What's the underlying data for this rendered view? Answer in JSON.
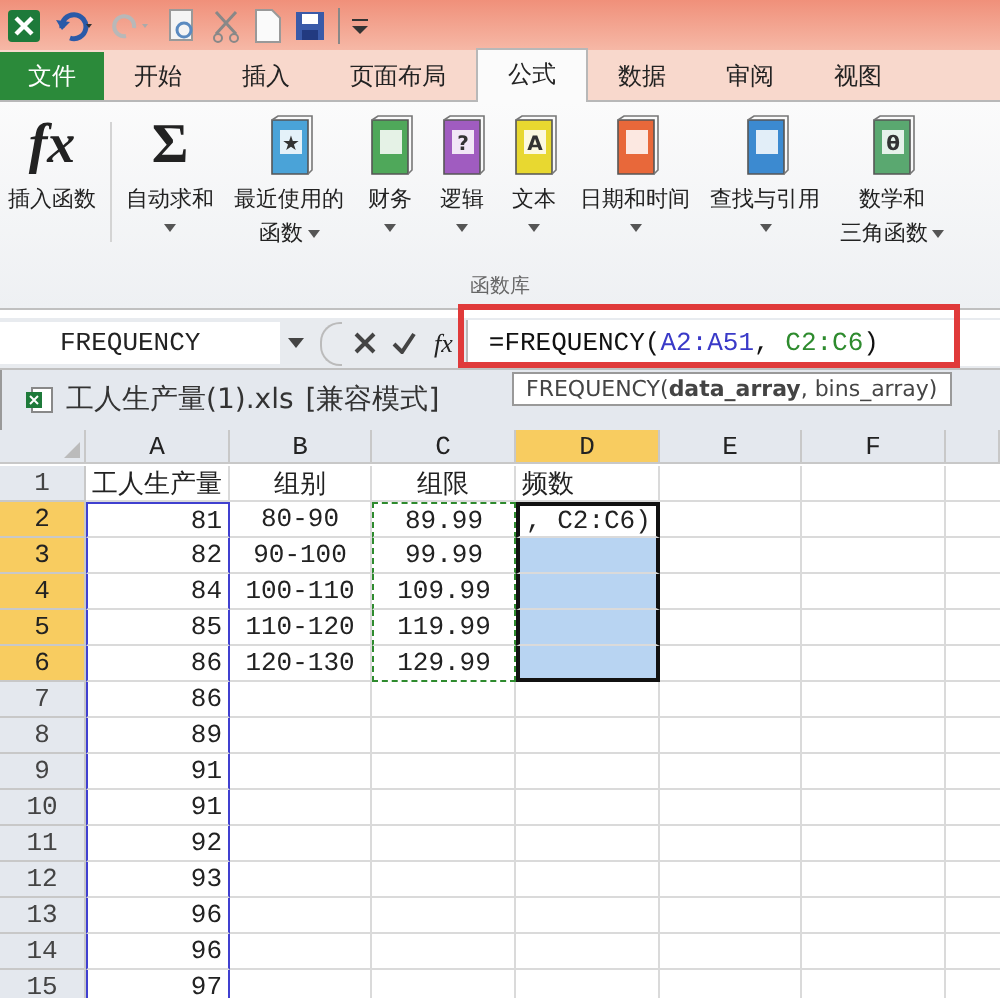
{
  "tabs": [
    {
      "label": "文件",
      "kind": "file",
      "selected": false
    },
    {
      "label": "开始",
      "kind": "normal",
      "selected": false
    },
    {
      "label": "插入",
      "kind": "normal",
      "selected": false
    },
    {
      "label": "页面布局",
      "kind": "normal",
      "selected": false
    },
    {
      "label": "公式",
      "kind": "normal",
      "selected": true
    },
    {
      "label": "数据",
      "kind": "normal",
      "selected": false
    },
    {
      "label": "审阅",
      "kind": "normal",
      "selected": false
    },
    {
      "label": "视图",
      "kind": "normal",
      "selected": false
    }
  ],
  "ribbon": {
    "buttons": [
      {
        "kind": "glyph",
        "glyph": "fx",
        "lines": [
          "插入函数"
        ],
        "dropdown": false
      },
      {
        "kind": "glyph",
        "glyph": "Σ",
        "lines": [
          "自动求和"
        ],
        "dropdown": true
      },
      {
        "kind": "book",
        "color": "#4aa3d8",
        "glyph": "★",
        "lines": [
          "最近使用的",
          "函数"
        ],
        "dropdown": true
      },
      {
        "kind": "book",
        "color": "#4fa85a",
        "lines": [
          "财务"
        ],
        "dropdown": true
      },
      {
        "kind": "book",
        "color": "#a05cc0",
        "glyph": "?",
        "lines": [
          "逻辑"
        ],
        "dropdown": true
      },
      {
        "kind": "book",
        "color": "#e8d830",
        "glyph": "A",
        "lines": [
          "文本"
        ],
        "dropdown": true
      },
      {
        "kind": "book",
        "color": "#e8683a",
        "lines": [
          "日期和时间"
        ],
        "dropdown": true
      },
      {
        "kind": "book",
        "color": "#3c8ad0",
        "lines": [
          "查找与引用"
        ],
        "dropdown": true
      },
      {
        "kind": "book",
        "color": "#5aa870",
        "glyph": "θ",
        "lines": [
          "数学和",
          "三角函数"
        ],
        "dropdown": true
      }
    ],
    "group_label": "函数库"
  },
  "formula_bar": {
    "name_box": "FREQUENCY",
    "fx_label": "fx",
    "formula": [
      {
        "text": "=FREQUENCY("
      },
      {
        "text": "A2:A51",
        "color": "#3a3ac8"
      },
      {
        "text": ", "
      },
      {
        "text": "C2:C6",
        "color": "#2e8b2e"
      },
      {
        "text": ")"
      }
    ],
    "tooltip": "FREQUENCY(**data_array**, bins_array)"
  },
  "workbook": {
    "title": "工人生产量(1).xls",
    "mode": "[兼容模式]"
  },
  "sheet": {
    "columns": [
      {
        "label": "A",
        "selected": false
      },
      {
        "label": "B",
        "selected": false
      },
      {
        "label": "C",
        "selected": false
      },
      {
        "label": "D",
        "selected": true
      },
      {
        "label": "E",
        "selected": false
      },
      {
        "label": "F",
        "selected": false
      }
    ],
    "rows": [
      {
        "number": "1",
        "selected": false,
        "cells": [
          "工人生产量",
          "组别",
          "组限",
          "频数"
        ]
      },
      {
        "number": "2",
        "selected": true,
        "cells": [
          "81",
          "80-90",
          "89.99",
          ", C2:C6)"
        ]
      },
      {
        "number": "3",
        "selected": true,
        "cells": [
          "82",
          "90-100",
          "99.99"
        ]
      },
      {
        "number": "4",
        "selected": true,
        "cells": [
          "84",
          "100-110",
          "109.99"
        ]
      },
      {
        "number": "5",
        "selected": true,
        "cells": [
          "85",
          "110-120",
          "119.99"
        ]
      },
      {
        "number": "6",
        "selected": true,
        "cells": [
          "86",
          "120-130",
          "129.99"
        ]
      },
      {
        "number": "7",
        "selected": false,
        "cells": [
          "86"
        ]
      },
      {
        "number": "8",
        "selected": false,
        "cells": [
          "89"
        ]
      },
      {
        "number": "9",
        "selected": false,
        "cells": [
          "91"
        ]
      },
      {
        "number": "10",
        "selected": false,
        "cells": [
          "91"
        ]
      },
      {
        "number": "11",
        "selected": false,
        "cells": [
          "92"
        ]
      },
      {
        "number": "12",
        "selected": false,
        "cells": [
          "93"
        ]
      },
      {
        "number": "13",
        "selected": false,
        "cells": [
          "96"
        ]
      },
      {
        "number": "14",
        "selected": false,
        "cells": [
          "96"
        ]
      },
      {
        "number": "15",
        "selected": false,
        "cells": [
          "97"
        ]
      }
    ]
  }
}
